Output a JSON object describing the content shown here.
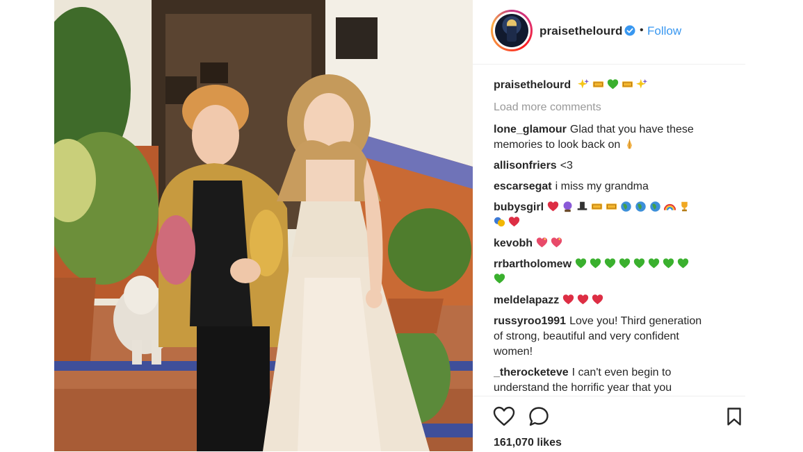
{
  "header": {
    "username": "praisethelourd",
    "separator": "•",
    "follow_label": "Follow",
    "verified": true,
    "accent": "#3897f0"
  },
  "caption": {
    "username": "praisethelourd",
    "emojis": [
      "sparkles",
      "ticket",
      "green-heart",
      "ticket",
      "sparkles"
    ]
  },
  "load_more": "Load more comments",
  "comments": [
    {
      "user": "lone_glamour",
      "text": "Glad that you have these",
      "text2": "memories to look back on",
      "emojis": [
        "folded-hands"
      ]
    },
    {
      "user": "allisonfriers",
      "text": "<3",
      "emojis": []
    },
    {
      "user": "escarsegat",
      "text": "i miss my grandma",
      "emojis": []
    },
    {
      "user": "bubysgirl",
      "text": "",
      "emojis": [
        "red-heart",
        "crystal-ball",
        "top-hat",
        "ticket",
        "ticket",
        "globe",
        "globe",
        "globe",
        "rainbow",
        "trophy"
      ],
      "emojis2": [
        "performing-arts",
        "red-heart"
      ]
    },
    {
      "user": "kevobh",
      "text": "",
      "emojis": [
        "sparkling-heart",
        "sparkling-heart"
      ]
    },
    {
      "user": "rrbartholomew",
      "text": "",
      "emojis": [
        "green-heart",
        "green-heart",
        "green-heart",
        "green-heart",
        "green-heart",
        "green-heart",
        "green-heart",
        "green-heart"
      ],
      "emojis2": [
        "green-heart"
      ]
    },
    {
      "user": "meldelapazz",
      "text": "",
      "emojis": [
        "red-heart",
        "red-heart",
        "red-heart"
      ]
    },
    {
      "user": "russyroo1991",
      "text": "Love you! Third generation",
      "text2": "of strong, beautiful and very confident",
      "text3": "women!",
      "emojis": []
    },
    {
      "user": "_therocketeve",
      "text": "I can't even begin to",
      "text2": "understand the horrific year that you",
      "emojis": []
    }
  ],
  "actions": {
    "like_icon": "heart-outline-icon",
    "comment_icon": "comment-bubble-icon",
    "save_icon": "bookmark-icon",
    "likes_text": "161,070 likes"
  }
}
